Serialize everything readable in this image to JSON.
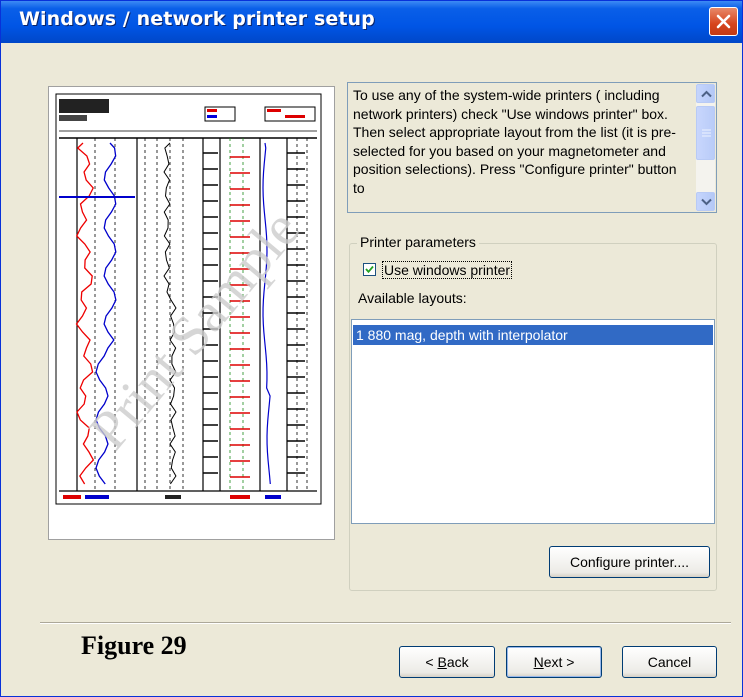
{
  "window": {
    "title": "Windows / network printer setup"
  },
  "help": {
    "text": "To use any of the system-wide printers ( including network printers) check \"Use windows printer\" box. Then select appropriate layout from the list (it is pre-selected for you based on your magnetometer and position selections). Press \"Configure printer\" button to"
  },
  "preview": {
    "watermark": "Print Sample"
  },
  "printer_params": {
    "group_label": "Printer parameters",
    "use_windows_printer_label": "Use windows printer",
    "use_windows_printer_checked": true,
    "available_layouts_label": "Available layouts:",
    "layouts": [
      "1 880 mag, depth with interpolator"
    ],
    "selected_layout": "1 880 mag, depth with interpolator",
    "configure_button": "Configure printer...."
  },
  "footer": {
    "figure_caption": "Figure 29",
    "back_mnemonic": "B",
    "back_rest": "ack",
    "back_prefix": "< ",
    "next_mnemonic": "N",
    "next_rest": "ext >",
    "cancel_label": "Cancel"
  },
  "colors": {
    "titlebar": "#0055e5",
    "selection": "#316ac5",
    "dialog_bg": "#ece9d8",
    "close_button": "#d6441c"
  },
  "icons": [
    "close-icon",
    "scroll-up-icon",
    "scroll-down-icon",
    "checkmark-icon"
  ]
}
